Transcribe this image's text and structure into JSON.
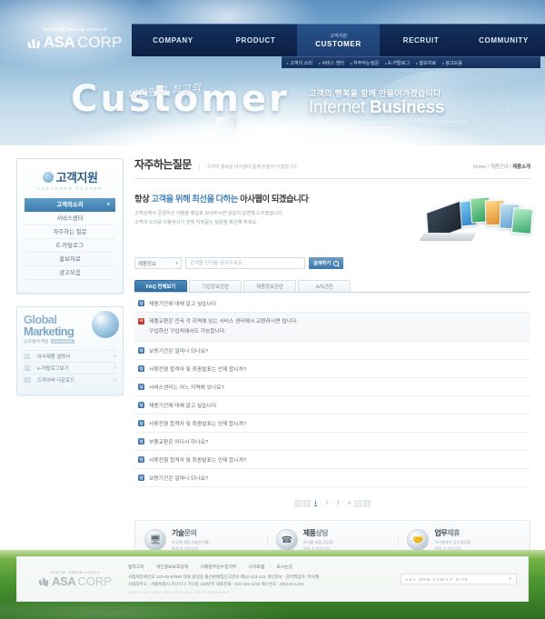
{
  "brand": {
    "tagline": "DIGITAL DREAM UTOPIA",
    "name": "ASA",
    "name_suffix": "CORP"
  },
  "nav": {
    "items": [
      {
        "label": "COMPANY",
        "kr": ""
      },
      {
        "label": "PRODUCT",
        "kr": ""
      },
      {
        "label": "CUSTOMER",
        "kr": "고객지원"
      },
      {
        "label": "RECRUIT",
        "kr": ""
      },
      {
        "label": "COMMUNITY",
        "kr": ""
      }
    ],
    "submenu": [
      "고객의 소리",
      "서비스 센터",
      "자주하는질문",
      "E-카탈로그",
      "홍보자료",
      "광고모음"
    ]
  },
  "banner": {
    "script": "대한민국 최고의",
    "word": "Customer",
    "kr_line": "고객의 행복을 함께 만들어가겠습니다",
    "en_line_light": "Internet ",
    "en_line_bold": "Business",
    "small_text": "Asa web has been running one of the biggest internet web sites in korea since that year. Asa web is a full size company that provides total solutions for internet business."
  },
  "sidebar": {
    "title": "고객지원",
    "subtitle": "CUSTOMER CENTER",
    "items": [
      {
        "label": "고객의소리",
        "active": true
      },
      {
        "label": "서비스센터",
        "active": false
      },
      {
        "label": "자주하는 질문",
        "active": false
      },
      {
        "label": "E-카탈로그",
        "active": false
      },
      {
        "label": "홍보자료",
        "active": false
      },
      {
        "label": "광고모음",
        "active": false
      }
    ],
    "banner": {
      "line1": "Global",
      "line2": "Marketing",
      "kr": "글로벌마케팅",
      "kr_badge": "ASAWEB",
      "items": [
        {
          "num": "01",
          "label": "아사제품 설명서"
        },
        {
          "num": "02",
          "label": "e-카탈로그보기"
        },
        {
          "num": "03",
          "label": "드라이버 다운로드"
        }
      ]
    }
  },
  "content": {
    "title": "자주하는질문",
    "desc": "고객의 행복을 아사웹이 함께 만들어 가겠습니다.",
    "breadcrumb": {
      "home": "Home",
      "level1": "제품안내",
      "level2": "제품소개"
    },
    "intro": {
      "head_a": "항상 ",
      "head_hl": "고객을 위해 최선을 다하는",
      "head_b": " 아사웹이 되겠습니다",
      "p1": "고객님께서 궁금하신 사항을 메일로 보내주시면 성실히 답변해 드리겠습니다.",
      "p2": "고객의 소리를 이용하시기 전에 자주묻는 질문을 확인해 주세요."
    },
    "search": {
      "select_value": "제품정보",
      "placeholder": "검색할 단어를 넣어주세요",
      "button": "검색하기"
    },
    "tabs": [
      {
        "label": "FAQ 전체보기",
        "active": true
      },
      {
        "label": "기업정보관련",
        "active": false
      },
      {
        "label": "제품정보관련",
        "active": false
      },
      {
        "label": "A/S관련",
        "active": false
      }
    ],
    "faq_badges": {
      "question": "Q",
      "answer": "A"
    },
    "faq": [
      {
        "type": "q",
        "text": "채용기간에 대해 알고 싶습니다"
      },
      {
        "type": "a",
        "line1": "제품교환은 전국 각 지역에 있는 서비스 센터에서 교환하시면 됩니다.",
        "line2": "구입하신 구입처에서도 가능합니다."
      },
      {
        "type": "q",
        "text": "보증기간은 얼마나 되나요?"
      },
      {
        "type": "q",
        "text": "서류전형 합격자 및 최종발표는 언제 합니까?"
      },
      {
        "type": "q",
        "text": "서비스센터는 어느 지역에 있나요?"
      },
      {
        "type": "q",
        "text": "채용기간에 대해 알고 싶습니다"
      },
      {
        "type": "q",
        "text": "서류전형 합격자 및 최종발표는 언제 합니까?"
      },
      {
        "type": "q",
        "text": "부품교환은 어디서 하나요?"
      },
      {
        "type": "q",
        "text": "서류전형 합격자 및 최종발표는 언제 합니까?"
      },
      {
        "type": "q",
        "text": "보증기간은 얼마나 되나요?"
      }
    ],
    "pagination": {
      "pages": [
        "1",
        "2",
        "3",
        "4"
      ],
      "current": "1"
    },
    "services": [
      {
        "icon": "monitor-icon",
        "glyph": "🖥",
        "title_bold": "기술",
        "title_light": "문의",
        "d1": "아사웹 제품 기술문의를",
        "d2": "하실 수 있습니다."
      },
      {
        "icon": "phone-icon",
        "glyph": "☎",
        "title_bold": "제품",
        "title_light": "상담",
        "d1": "아사웹 제품 상담을",
        "d2": "하실 수 있습니다."
      },
      {
        "icon": "handshake-icon",
        "glyph": "🤝",
        "title_bold": "업무",
        "title_light": "제휴",
        "d1": "아사웹과의 업무제휴를",
        "d2": "하실 수 있습니다."
      }
    ]
  },
  "footer": {
    "tagline": "DIGITAL DREAM UTOPIA",
    "name": "ASA",
    "name_suffix": "CORP",
    "links": [
      "법적고지",
      "개인정보보호정책",
      "이메일무단수집거부",
      "사이트맵",
      "오시는길"
    ],
    "info1": "사업자등록번호:123-45-67890 대표:홍길동 통신판매업신고번호:제12-123-123 개인정보 · 관리책임자 :아사웹",
    "info2": "사업장주소 : 서울특별시 가나다구 가나동 123번지 대표전화 : 02)-123-1234 팩스번호 : 02)123-1234",
    "copyright": "COPYRIGHT 2007 ASA CORP. ALL RIGHT RESERVED.",
    "family_site": "ASA WEB FAMILY SITE"
  }
}
